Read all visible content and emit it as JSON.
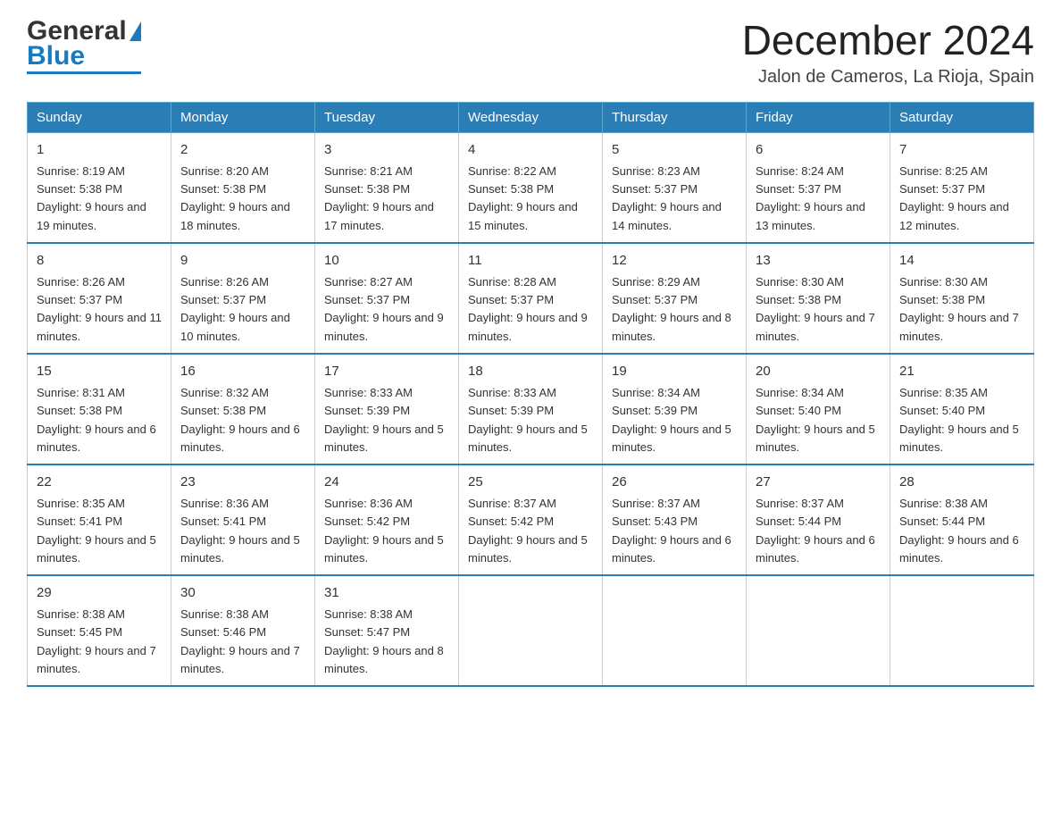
{
  "header": {
    "logo_general": "General",
    "logo_blue": "Blue",
    "title": "December 2024",
    "subtitle": "Jalon de Cameros, La Rioja, Spain"
  },
  "weekdays": [
    "Sunday",
    "Monday",
    "Tuesday",
    "Wednesday",
    "Thursday",
    "Friday",
    "Saturday"
  ],
  "weeks": [
    [
      {
        "day": "1",
        "sunrise": "8:19 AM",
        "sunset": "5:38 PM",
        "daylight": "9 hours and 19 minutes."
      },
      {
        "day": "2",
        "sunrise": "8:20 AM",
        "sunset": "5:38 PM",
        "daylight": "9 hours and 18 minutes."
      },
      {
        "day": "3",
        "sunrise": "8:21 AM",
        "sunset": "5:38 PM",
        "daylight": "9 hours and 17 minutes."
      },
      {
        "day": "4",
        "sunrise": "8:22 AM",
        "sunset": "5:38 PM",
        "daylight": "9 hours and 15 minutes."
      },
      {
        "day": "5",
        "sunrise": "8:23 AM",
        "sunset": "5:37 PM",
        "daylight": "9 hours and 14 minutes."
      },
      {
        "day": "6",
        "sunrise": "8:24 AM",
        "sunset": "5:37 PM",
        "daylight": "9 hours and 13 minutes."
      },
      {
        "day": "7",
        "sunrise": "8:25 AM",
        "sunset": "5:37 PM",
        "daylight": "9 hours and 12 minutes."
      }
    ],
    [
      {
        "day": "8",
        "sunrise": "8:26 AM",
        "sunset": "5:37 PM",
        "daylight": "9 hours and 11 minutes."
      },
      {
        "day": "9",
        "sunrise": "8:26 AM",
        "sunset": "5:37 PM",
        "daylight": "9 hours and 10 minutes."
      },
      {
        "day": "10",
        "sunrise": "8:27 AM",
        "sunset": "5:37 PM",
        "daylight": "9 hours and 9 minutes."
      },
      {
        "day": "11",
        "sunrise": "8:28 AM",
        "sunset": "5:37 PM",
        "daylight": "9 hours and 9 minutes."
      },
      {
        "day": "12",
        "sunrise": "8:29 AM",
        "sunset": "5:37 PM",
        "daylight": "9 hours and 8 minutes."
      },
      {
        "day": "13",
        "sunrise": "8:30 AM",
        "sunset": "5:38 PM",
        "daylight": "9 hours and 7 minutes."
      },
      {
        "day": "14",
        "sunrise": "8:30 AM",
        "sunset": "5:38 PM",
        "daylight": "9 hours and 7 minutes."
      }
    ],
    [
      {
        "day": "15",
        "sunrise": "8:31 AM",
        "sunset": "5:38 PM",
        "daylight": "9 hours and 6 minutes."
      },
      {
        "day": "16",
        "sunrise": "8:32 AM",
        "sunset": "5:38 PM",
        "daylight": "9 hours and 6 minutes."
      },
      {
        "day": "17",
        "sunrise": "8:33 AM",
        "sunset": "5:39 PM",
        "daylight": "9 hours and 5 minutes."
      },
      {
        "day": "18",
        "sunrise": "8:33 AM",
        "sunset": "5:39 PM",
        "daylight": "9 hours and 5 minutes."
      },
      {
        "day": "19",
        "sunrise": "8:34 AM",
        "sunset": "5:39 PM",
        "daylight": "9 hours and 5 minutes."
      },
      {
        "day": "20",
        "sunrise": "8:34 AM",
        "sunset": "5:40 PM",
        "daylight": "9 hours and 5 minutes."
      },
      {
        "day": "21",
        "sunrise": "8:35 AM",
        "sunset": "5:40 PM",
        "daylight": "9 hours and 5 minutes."
      }
    ],
    [
      {
        "day": "22",
        "sunrise": "8:35 AM",
        "sunset": "5:41 PM",
        "daylight": "9 hours and 5 minutes."
      },
      {
        "day": "23",
        "sunrise": "8:36 AM",
        "sunset": "5:41 PM",
        "daylight": "9 hours and 5 minutes."
      },
      {
        "day": "24",
        "sunrise": "8:36 AM",
        "sunset": "5:42 PM",
        "daylight": "9 hours and 5 minutes."
      },
      {
        "day": "25",
        "sunrise": "8:37 AM",
        "sunset": "5:42 PM",
        "daylight": "9 hours and 5 minutes."
      },
      {
        "day": "26",
        "sunrise": "8:37 AM",
        "sunset": "5:43 PM",
        "daylight": "9 hours and 6 minutes."
      },
      {
        "day": "27",
        "sunrise": "8:37 AM",
        "sunset": "5:44 PM",
        "daylight": "9 hours and 6 minutes."
      },
      {
        "day": "28",
        "sunrise": "8:38 AM",
        "sunset": "5:44 PM",
        "daylight": "9 hours and 6 minutes."
      }
    ],
    [
      {
        "day": "29",
        "sunrise": "8:38 AM",
        "sunset": "5:45 PM",
        "daylight": "9 hours and 7 minutes."
      },
      {
        "day": "30",
        "sunrise": "8:38 AM",
        "sunset": "5:46 PM",
        "daylight": "9 hours and 7 minutes."
      },
      {
        "day": "31",
        "sunrise": "8:38 AM",
        "sunset": "5:47 PM",
        "daylight": "9 hours and 8 minutes."
      },
      null,
      null,
      null,
      null
    ]
  ],
  "labels": {
    "sunrise_prefix": "Sunrise: ",
    "sunset_prefix": "Sunset: ",
    "daylight_prefix": "Daylight: "
  }
}
